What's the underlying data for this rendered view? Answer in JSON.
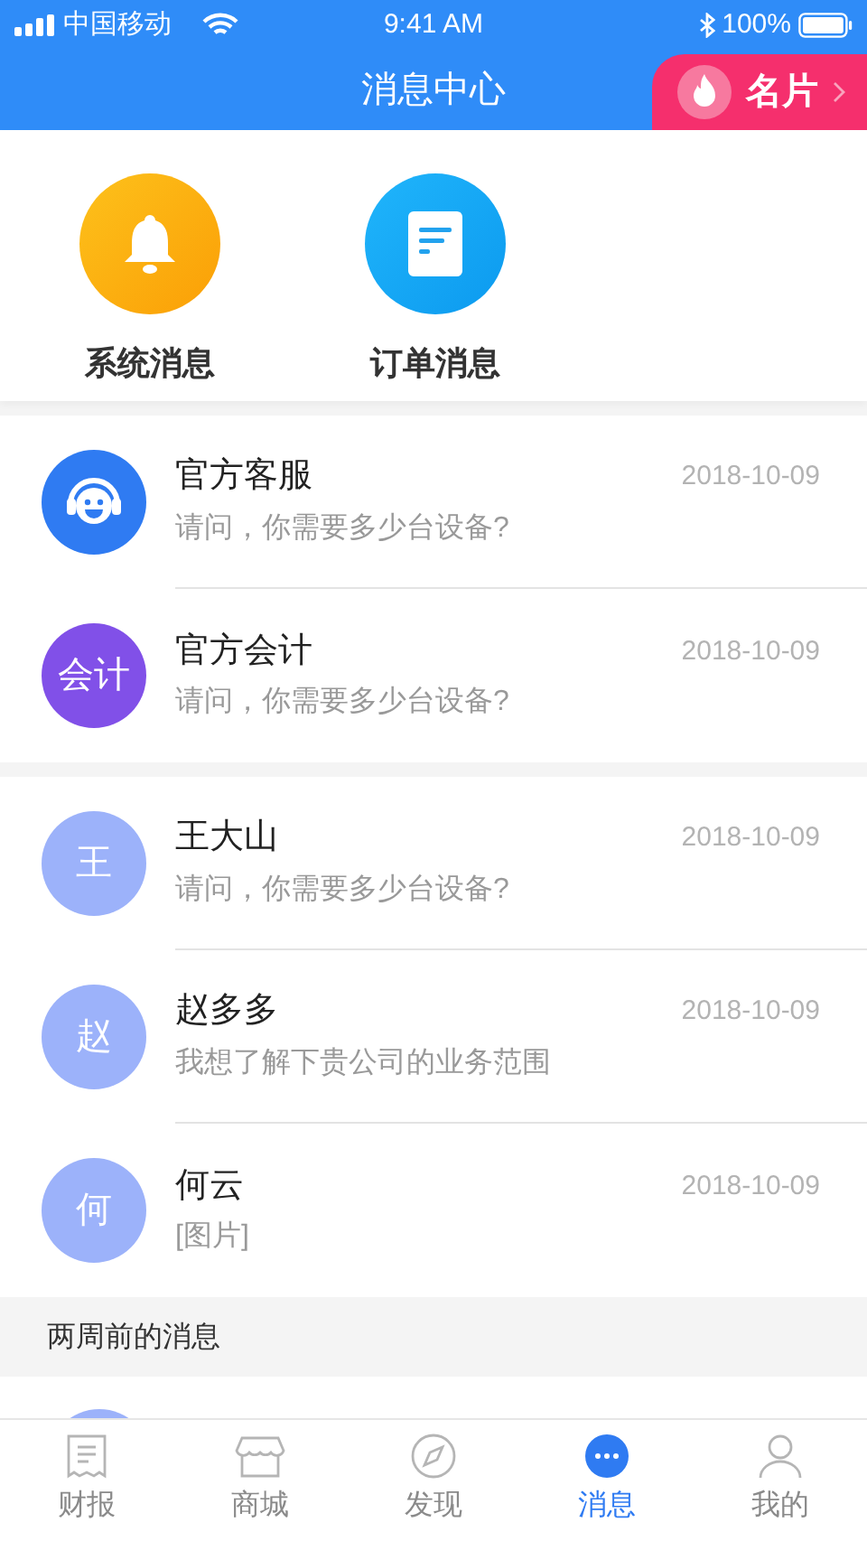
{
  "status_bar": {
    "carrier": "中国移动",
    "time": "9:41 AM",
    "battery": "100%"
  },
  "header": {
    "title": "消息中心",
    "card_button": "名片"
  },
  "shortcuts": [
    {
      "kind": "bell",
      "label": "系统消息"
    },
    {
      "kind": "document",
      "label": "订单消息"
    }
  ],
  "groups": [
    {
      "messages": [
        {
          "avatar": {
            "kind": "headset"
          },
          "name": "官方客服",
          "date": "2018-10-09",
          "preview": "请问，你需要多少台设备?"
        },
        {
          "avatar": {
            "kind": "text",
            "text": "会计",
            "color": "#8150e8"
          },
          "name": "官方会计",
          "date": "2018-10-09",
          "preview": "请问，你需要多少台设备?"
        }
      ]
    },
    {
      "messages": [
        {
          "avatar": {
            "kind": "text",
            "text": "王",
            "color": "#9cb2fa"
          },
          "name": "王大山",
          "date": "2018-10-09",
          "preview": "请问，你需要多少台设备?"
        },
        {
          "avatar": {
            "kind": "text",
            "text": "赵",
            "color": "#9cb2fa"
          },
          "name": "赵多多",
          "date": "2018-10-09",
          "preview": "我想了解下贵公司的业务范围"
        },
        {
          "avatar": {
            "kind": "text",
            "text": "何",
            "color": "#9cb2fa"
          },
          "name": "何云",
          "date": "2018-10-09",
          "preview": "[图片]"
        }
      ]
    }
  ],
  "older_section": {
    "title": "两周前的消息"
  },
  "tabs": [
    {
      "kind": "receipt",
      "label": "财报",
      "selected": false
    },
    {
      "kind": "store",
      "label": "商城",
      "selected": false
    },
    {
      "kind": "compass",
      "label": "发现",
      "selected": false
    },
    {
      "kind": "chat",
      "label": "消息",
      "selected": true
    },
    {
      "kind": "person",
      "label": "我的",
      "selected": false
    }
  ]
}
